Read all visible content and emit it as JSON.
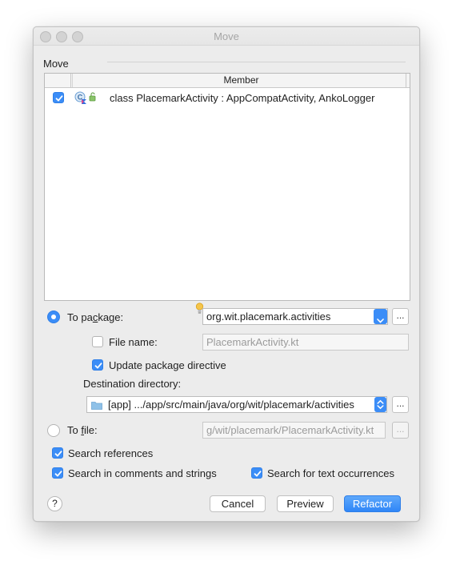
{
  "window": {
    "title": "Move"
  },
  "move_section": {
    "label": "Move",
    "table": {
      "header": "Member",
      "rows": [
        {
          "checked": true,
          "text": "class PlacemarkActivity : AppCompatActivity, AnkoLogger"
        }
      ]
    }
  },
  "to_package": {
    "label_pre": "To pa",
    "label_mnemonic": "c",
    "label_post": "kage:",
    "selected": true,
    "value": "org.wit.placemark.activities",
    "browse_label": "..."
  },
  "file_name": {
    "label": "File name:",
    "checked": false,
    "value": "PlacemarkActivity.kt"
  },
  "update_package_directive": {
    "label": "Update package directive",
    "checked": true
  },
  "destination_directory": {
    "label": "Destination directory:",
    "module": "[app]",
    "path": ".../app/src/main/java/org/wit/placemark/activities",
    "browse_label": "..."
  },
  "to_file": {
    "label_pre": "To ",
    "label_mnemonic": "f",
    "label_post": "ile:",
    "selected": false,
    "value": "ɡ/wit/placemark/PlacemarkActivity.kt",
    "browse_label": "..."
  },
  "options": {
    "search_references": {
      "label": "Search references",
      "checked": true
    },
    "search_comments_strings": {
      "label": "Search in comments and strings",
      "checked": true
    },
    "search_text_occurrences": {
      "label": "Search for text occurrences",
      "checked": true
    }
  },
  "buttons": {
    "help": "?",
    "cancel": "Cancel",
    "preview": "Preview",
    "refactor": "Refactor"
  },
  "colors": {
    "accent": "#3b8df7",
    "window_bg": "#ececec"
  }
}
